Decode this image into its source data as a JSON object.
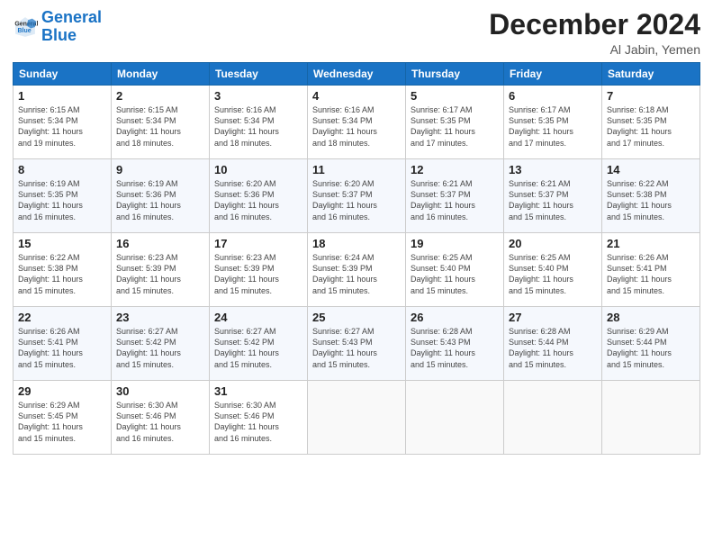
{
  "logo": {
    "line1": "General",
    "line2": "Blue"
  },
  "title": "December 2024",
  "location": "Al Jabin, Yemen",
  "days_of_week": [
    "Sunday",
    "Monday",
    "Tuesday",
    "Wednesday",
    "Thursday",
    "Friday",
    "Saturday"
  ],
  "weeks": [
    [
      {
        "day": "1",
        "detail": "Sunrise: 6:15 AM\nSunset: 5:34 PM\nDaylight: 11 hours\nand 19 minutes."
      },
      {
        "day": "2",
        "detail": "Sunrise: 6:15 AM\nSunset: 5:34 PM\nDaylight: 11 hours\nand 18 minutes."
      },
      {
        "day": "3",
        "detail": "Sunrise: 6:16 AM\nSunset: 5:34 PM\nDaylight: 11 hours\nand 18 minutes."
      },
      {
        "day": "4",
        "detail": "Sunrise: 6:16 AM\nSunset: 5:34 PM\nDaylight: 11 hours\nand 18 minutes."
      },
      {
        "day": "5",
        "detail": "Sunrise: 6:17 AM\nSunset: 5:35 PM\nDaylight: 11 hours\nand 17 minutes."
      },
      {
        "day": "6",
        "detail": "Sunrise: 6:17 AM\nSunset: 5:35 PM\nDaylight: 11 hours\nand 17 minutes."
      },
      {
        "day": "7",
        "detail": "Sunrise: 6:18 AM\nSunset: 5:35 PM\nDaylight: 11 hours\nand 17 minutes."
      }
    ],
    [
      {
        "day": "8",
        "detail": "Sunrise: 6:19 AM\nSunset: 5:35 PM\nDaylight: 11 hours\nand 16 minutes."
      },
      {
        "day": "9",
        "detail": "Sunrise: 6:19 AM\nSunset: 5:36 PM\nDaylight: 11 hours\nand 16 minutes."
      },
      {
        "day": "10",
        "detail": "Sunrise: 6:20 AM\nSunset: 5:36 PM\nDaylight: 11 hours\nand 16 minutes."
      },
      {
        "day": "11",
        "detail": "Sunrise: 6:20 AM\nSunset: 5:37 PM\nDaylight: 11 hours\nand 16 minutes."
      },
      {
        "day": "12",
        "detail": "Sunrise: 6:21 AM\nSunset: 5:37 PM\nDaylight: 11 hours\nand 16 minutes."
      },
      {
        "day": "13",
        "detail": "Sunrise: 6:21 AM\nSunset: 5:37 PM\nDaylight: 11 hours\nand 15 minutes."
      },
      {
        "day": "14",
        "detail": "Sunrise: 6:22 AM\nSunset: 5:38 PM\nDaylight: 11 hours\nand 15 minutes."
      }
    ],
    [
      {
        "day": "15",
        "detail": "Sunrise: 6:22 AM\nSunset: 5:38 PM\nDaylight: 11 hours\nand 15 minutes."
      },
      {
        "day": "16",
        "detail": "Sunrise: 6:23 AM\nSunset: 5:39 PM\nDaylight: 11 hours\nand 15 minutes."
      },
      {
        "day": "17",
        "detail": "Sunrise: 6:23 AM\nSunset: 5:39 PM\nDaylight: 11 hours\nand 15 minutes."
      },
      {
        "day": "18",
        "detail": "Sunrise: 6:24 AM\nSunset: 5:39 PM\nDaylight: 11 hours\nand 15 minutes."
      },
      {
        "day": "19",
        "detail": "Sunrise: 6:25 AM\nSunset: 5:40 PM\nDaylight: 11 hours\nand 15 minutes."
      },
      {
        "day": "20",
        "detail": "Sunrise: 6:25 AM\nSunset: 5:40 PM\nDaylight: 11 hours\nand 15 minutes."
      },
      {
        "day": "21",
        "detail": "Sunrise: 6:26 AM\nSunset: 5:41 PM\nDaylight: 11 hours\nand 15 minutes."
      }
    ],
    [
      {
        "day": "22",
        "detail": "Sunrise: 6:26 AM\nSunset: 5:41 PM\nDaylight: 11 hours\nand 15 minutes."
      },
      {
        "day": "23",
        "detail": "Sunrise: 6:27 AM\nSunset: 5:42 PM\nDaylight: 11 hours\nand 15 minutes."
      },
      {
        "day": "24",
        "detail": "Sunrise: 6:27 AM\nSunset: 5:42 PM\nDaylight: 11 hours\nand 15 minutes."
      },
      {
        "day": "25",
        "detail": "Sunrise: 6:27 AM\nSunset: 5:43 PM\nDaylight: 11 hours\nand 15 minutes."
      },
      {
        "day": "26",
        "detail": "Sunrise: 6:28 AM\nSunset: 5:43 PM\nDaylight: 11 hours\nand 15 minutes."
      },
      {
        "day": "27",
        "detail": "Sunrise: 6:28 AM\nSunset: 5:44 PM\nDaylight: 11 hours\nand 15 minutes."
      },
      {
        "day": "28",
        "detail": "Sunrise: 6:29 AM\nSunset: 5:44 PM\nDaylight: 11 hours\nand 15 minutes."
      }
    ],
    [
      {
        "day": "29",
        "detail": "Sunrise: 6:29 AM\nSunset: 5:45 PM\nDaylight: 11 hours\nand 15 minutes."
      },
      {
        "day": "30",
        "detail": "Sunrise: 6:30 AM\nSunset: 5:46 PM\nDaylight: 11 hours\nand 16 minutes."
      },
      {
        "day": "31",
        "detail": "Sunrise: 6:30 AM\nSunset: 5:46 PM\nDaylight: 11 hours\nand 16 minutes."
      },
      {
        "day": "",
        "detail": ""
      },
      {
        "day": "",
        "detail": ""
      },
      {
        "day": "",
        "detail": ""
      },
      {
        "day": "",
        "detail": ""
      }
    ]
  ]
}
